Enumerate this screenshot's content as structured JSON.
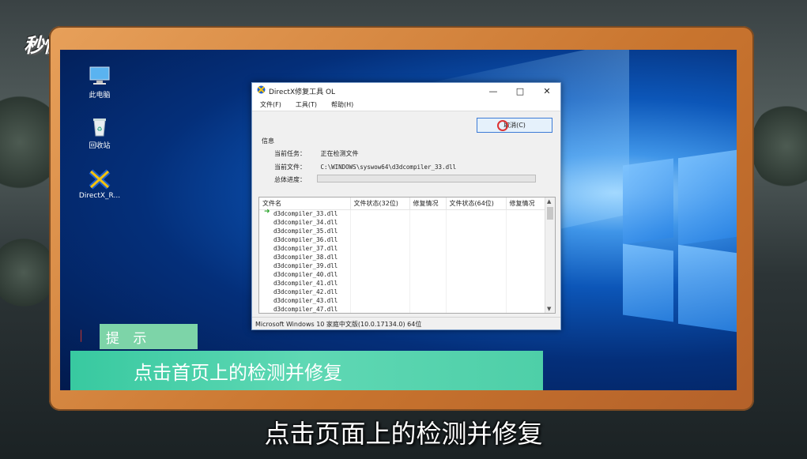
{
  "watermark": {
    "logo_text": "秒懂视频"
  },
  "desktop": {
    "icons": [
      {
        "label": "此电脑",
        "icon": "computer-icon"
      },
      {
        "label": "回收站",
        "icon": "recycle-bin-icon"
      },
      {
        "label": "DirectX_R...",
        "icon": "directx-repair-icon"
      }
    ]
  },
  "window": {
    "title": "DirectX修复工具 OL",
    "menu": [
      "文件(F)",
      "工具(T)",
      "帮助(H)"
    ],
    "cancel_label": "取消(C)",
    "info_label": "信息",
    "current_task_label": "当前任务：",
    "current_task_value": "正在检测文件",
    "current_file_label": "当前文件：",
    "current_file_value": "C:\\WINDOWS\\syswow64\\d3dcompiler_33.dll",
    "overall_progress_label": "总体进度：",
    "columns": [
      "文件名",
      "文件状态(32位)",
      "修复情况",
      "文件状态(64位)",
      "修复情况"
    ],
    "files": [
      "d3dcompiler_33.dll",
      "d3dcompiler_34.dll",
      "d3dcompiler_35.dll",
      "d3dcompiler_36.dll",
      "d3dcompiler_37.dll",
      "d3dcompiler_38.dll",
      "d3dcompiler_39.dll",
      "d3dcompiler_40.dll",
      "d3dcompiler_41.dll",
      "d3dcompiler_42.dll",
      "d3dcompiler_43.dll",
      "d3dcompiler_47.dll"
    ],
    "status_bar": "Microsoft Windows 10 家庭中文版(10.0.17134.0) 64位"
  },
  "tip": {
    "label": "提 示",
    "text": "点击首页上的检测并修复"
  },
  "subtitle": "点击页面上的检测并修复",
  "colors": {
    "accent_frame": "#d4843e",
    "tip_green": "#4ecfa8",
    "desktop_blue": "#0c56b8"
  }
}
